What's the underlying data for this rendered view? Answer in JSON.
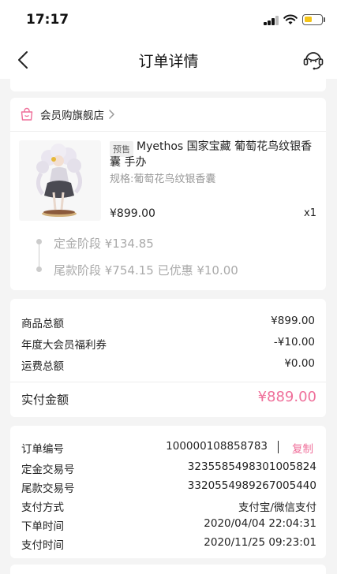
{
  "status_bar": {
    "time": "17:17"
  },
  "nav": {
    "title": "订单详情"
  },
  "store": {
    "name": "会员购旗舰店"
  },
  "product": {
    "tag": "预售",
    "name": "Myethos 国家宝藏 葡萄花鸟纹银香囊 手办",
    "spec": "规格:葡萄花鸟纹银香囊",
    "price": "¥899.00",
    "qty": "x1"
  },
  "stages": [
    {
      "text": "定金阶段 ¥134.85"
    },
    {
      "text": "尾款阶段 ¥754.15 已优惠 ¥10.00"
    }
  ],
  "summary": {
    "rows": [
      {
        "label": "商品总额",
        "value": "¥899.00"
      },
      {
        "label": "年度大会员福利券",
        "value": "-¥10.00"
      },
      {
        "label": "运费总额",
        "value": "¥0.00"
      }
    ],
    "paid_label": "实付金额",
    "paid_value": "¥889.00"
  },
  "info": {
    "order_no_label": "订单编号",
    "order_no_value": "100000108858783",
    "copy_label": "复制",
    "rows": [
      {
        "label": "定金交易号",
        "value": "3235585498301005824"
      },
      {
        "label": "尾款交易号",
        "value": "3320554989267005440"
      },
      {
        "label": "支付方式",
        "value": "支付宝/微信支付"
      },
      {
        "label": "下单时间",
        "value": "2020/04/04 22:04:31"
      },
      {
        "label": "支付时间",
        "value": "2020/11/25 09:23:01"
      }
    ]
  },
  "colors": {
    "accent_pink": "#ef6f9a",
    "battery_yellow": "#f5c518"
  },
  "icons": {
    "back": "chevron-left-icon",
    "service": "customer-service-icon",
    "store": "shopping-bag-icon",
    "store_arrow": "chevron-right-icon"
  }
}
